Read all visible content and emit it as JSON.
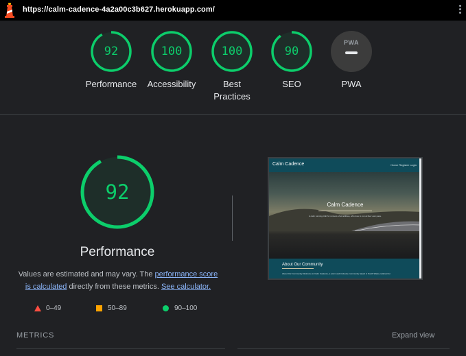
{
  "url_bar": {
    "url": "https://calm-cadence-4a2a00c3b627.herokuapp.com/"
  },
  "summary": [
    {
      "label": "Performance",
      "score": "92",
      "value": 0.92
    },
    {
      "label": "Accessibility",
      "score": "100",
      "value": 1.0
    },
    {
      "label": "Best Practices",
      "score": "100",
      "value": 1.0
    },
    {
      "label": "SEO",
      "score": "90",
      "value": 0.9
    }
  ],
  "pwa": {
    "badge": "PWA",
    "label": "PWA"
  },
  "performance": {
    "score": "92",
    "value": 0.92,
    "title": "Performance",
    "desc_pre": "Values are estimated and may vary. The ",
    "desc_link1": "performance score is calculated",
    "desc_mid": " directly from these metrics. ",
    "desc_link2": "See calculator."
  },
  "legend": [
    {
      "range": "0–49",
      "color": "#ff4e42"
    },
    {
      "range": "50–89",
      "color": "#ffa400"
    },
    {
      "range": "90–100",
      "color": "#0cce6b"
    }
  ],
  "metrics": {
    "label": "METRICS",
    "expand": "Expand view"
  },
  "screenshot": {
    "brand": "Calm Cadence",
    "nav_links": "Home   Register   Login",
    "hero_title": "Calm Cadence",
    "hero_sub": "A calm running club for runners of all abilities, who love to run at their own pace.",
    "about_title": "About Our Community",
    "about_text": "About Our Community Welcome to Calm Cadence, a warm and inclusive community based in South Wales, tailored for"
  },
  "colors": {
    "pass": "#0cce6b",
    "average": "#ffa400",
    "fail": "#ff4e42",
    "link": "#8ab4f8"
  }
}
